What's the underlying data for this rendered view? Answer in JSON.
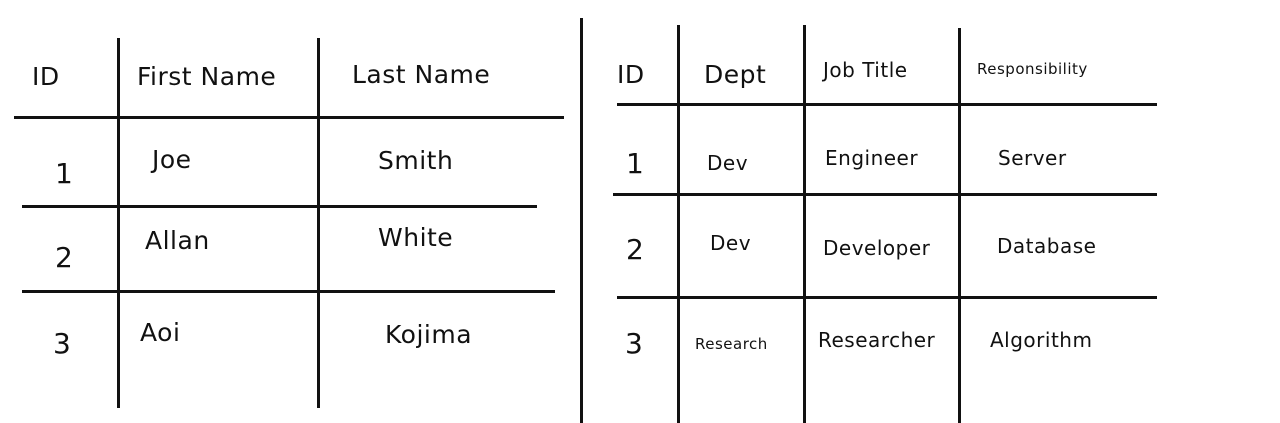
{
  "table_left": {
    "headers": [
      "ID",
      "First Name",
      "Last Name"
    ],
    "rows": [
      [
        "1",
        "Joe",
        "Smith"
      ],
      [
        "2",
        "Allan",
        "White"
      ],
      [
        "3",
        "Aoi",
        "Kojima"
      ]
    ]
  },
  "table_right": {
    "headers": [
      "ID",
      "Dept",
      "Job Title",
      "Responsibility"
    ],
    "rows": [
      [
        "1",
        "Dev",
        "Engineer",
        "Server"
      ],
      [
        "2",
        "Dev",
        "Developer",
        "Database"
      ],
      [
        "3",
        "Research",
        "Researcher",
        "Algorithm"
      ]
    ]
  }
}
